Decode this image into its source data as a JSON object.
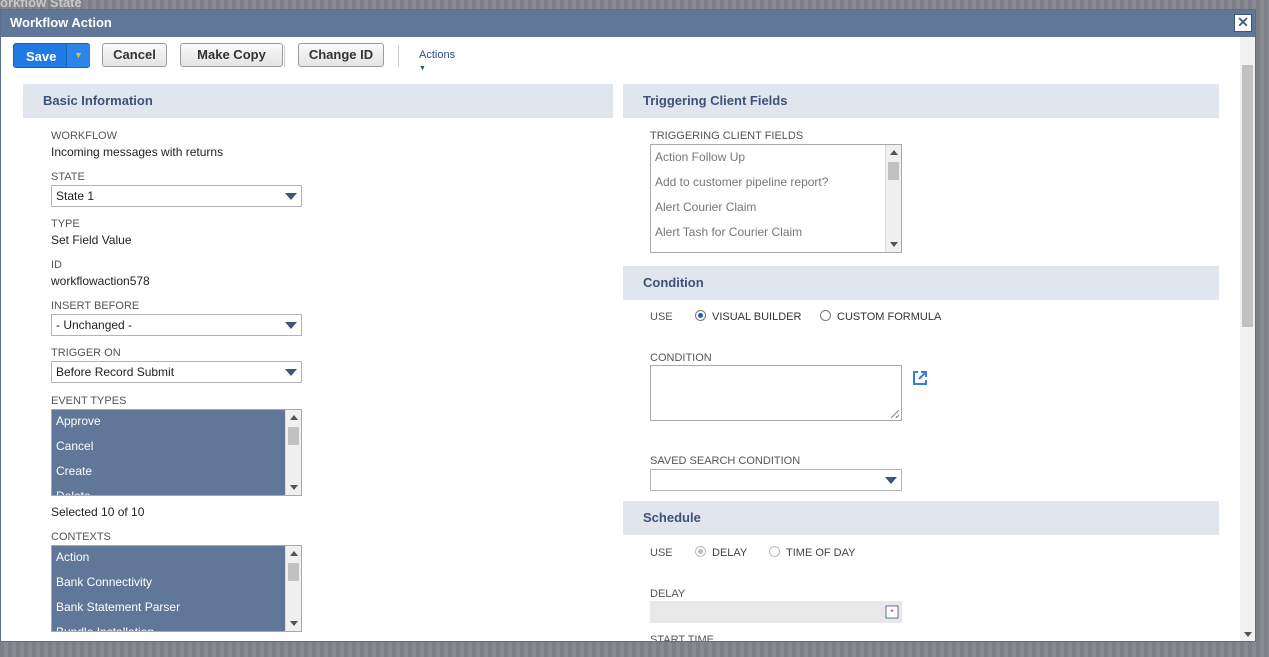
{
  "background": {
    "title": "orkflow State"
  },
  "window": {
    "title": "Workflow Action",
    "close_glyph": "✕"
  },
  "toolbar": {
    "save_label": "Save",
    "cancel_label": "Cancel",
    "make_copy_label": "Make Copy",
    "change_id_label": "Change ID",
    "actions_label": "Actions"
  },
  "basic": {
    "heading": "Basic Information",
    "workflow_label": "WORKFLOW",
    "workflow_value": "Incoming messages with returns",
    "state_label": "STATE",
    "state_value": "State 1",
    "type_label": "TYPE",
    "type_value": "Set Field Value",
    "id_label": "ID",
    "id_value": "workflowaction578",
    "insert_before_label": "INSERT BEFORE",
    "insert_before_value": "- Unchanged -",
    "trigger_on_label": "TRIGGER ON",
    "trigger_on_value": "Before Record Submit",
    "event_types_label": "EVENT TYPES",
    "event_types": [
      "Approve",
      "Cancel",
      "Create",
      "Delete"
    ],
    "event_types_count": "Selected 10 of 10",
    "contexts_label": "CONTEXTS",
    "contexts": [
      "Action",
      "Bank Connectivity",
      "Bank Statement Parser",
      "Bundle Installation"
    ]
  },
  "triggering": {
    "heading": "Triggering Client Fields",
    "label": "TRIGGERING CLIENT FIELDS",
    "items": [
      "Action Follow Up",
      "Add to customer pipeline report?",
      "Alert Courier Claim",
      "Alert Tash for Courier Claim"
    ]
  },
  "condition": {
    "heading": "Condition",
    "use_label": "USE",
    "visual_builder_label": "VISUAL BUILDER",
    "custom_formula_label": "CUSTOM FORMULA",
    "condition_label": "CONDITION",
    "saved_search_label": "SAVED SEARCH CONDITION",
    "saved_search_value": ""
  },
  "schedule": {
    "heading": "Schedule",
    "use_label": "USE",
    "delay_option_label": "DELAY",
    "time_of_day_label": "TIME OF DAY",
    "delay_label": "DELAY",
    "start_time_label": "START TIME"
  },
  "colors": {
    "titlebar": "#607799",
    "save_button": "#1f7ae3",
    "section_header": "#e1e6ee",
    "selected_list": "#617799"
  }
}
